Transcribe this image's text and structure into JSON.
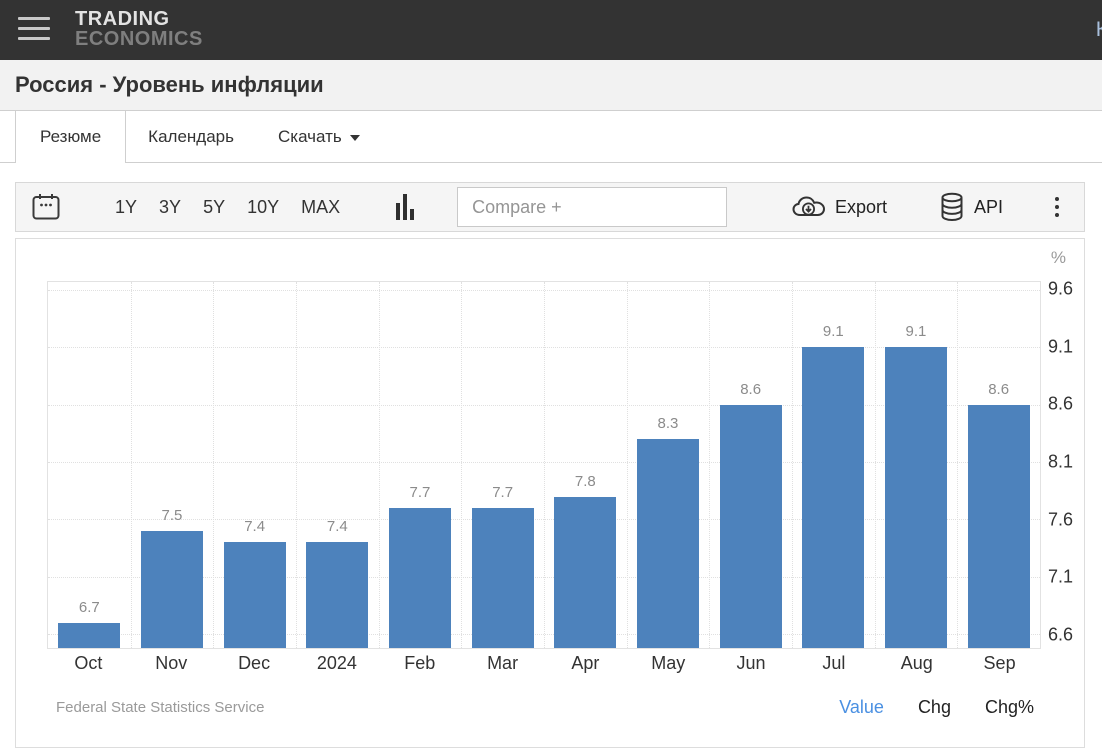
{
  "header": {
    "logo_line1": "TRADING",
    "logo_line2": "ECONOMICS",
    "partial_right_text": "К"
  },
  "page": {
    "title": "Россия - Уровень инфляции"
  },
  "tabs": [
    {
      "label": "Резюме",
      "active": true
    },
    {
      "label": "Календарь",
      "active": false
    },
    {
      "label": "Скачать",
      "active": false,
      "has_caret": true
    }
  ],
  "toolbar": {
    "ranges": [
      "1Y",
      "3Y",
      "5Y",
      "10Y",
      "MAX"
    ],
    "compare_placeholder": "Compare +",
    "export_label": "Export",
    "api_label": "API"
  },
  "chart_data": {
    "type": "bar",
    "title": "Россия - Уровень инфляции",
    "categories": [
      "Oct",
      "Nov",
      "Dec",
      "2024",
      "Feb",
      "Mar",
      "Apr",
      "May",
      "Jun",
      "Jul",
      "Aug",
      "Sep"
    ],
    "values": [
      6.7,
      7.5,
      7.4,
      7.4,
      7.7,
      7.7,
      7.8,
      8.3,
      8.6,
      9.1,
      9.1,
      8.6
    ],
    "unit": "%",
    "ylabel": "%",
    "y_ticks": [
      9.6,
      9.1,
      8.6,
      8.1,
      7.6,
      7.1,
      6.6
    ],
    "ylim": [
      6.48,
      9.67
    ],
    "grid": true,
    "legend": "none",
    "bar_color": "#4d82bc",
    "value_label_color": "#8b8b8b",
    "source": "Federal State Statistics Service"
  },
  "chart_footer": {
    "source": "Federal State Statistics Service",
    "links": [
      {
        "label": "Value",
        "active": true
      },
      {
        "label": "Chg",
        "active": false
      },
      {
        "label": "Chg%",
        "active": false
      }
    ]
  },
  "colors": {
    "header_bg": "#333333",
    "title_strip_bg": "#f2f2f2",
    "accent_blue": "#4a90e2",
    "bar_blue": "#4d82bc",
    "border": "#cfcfcf"
  }
}
